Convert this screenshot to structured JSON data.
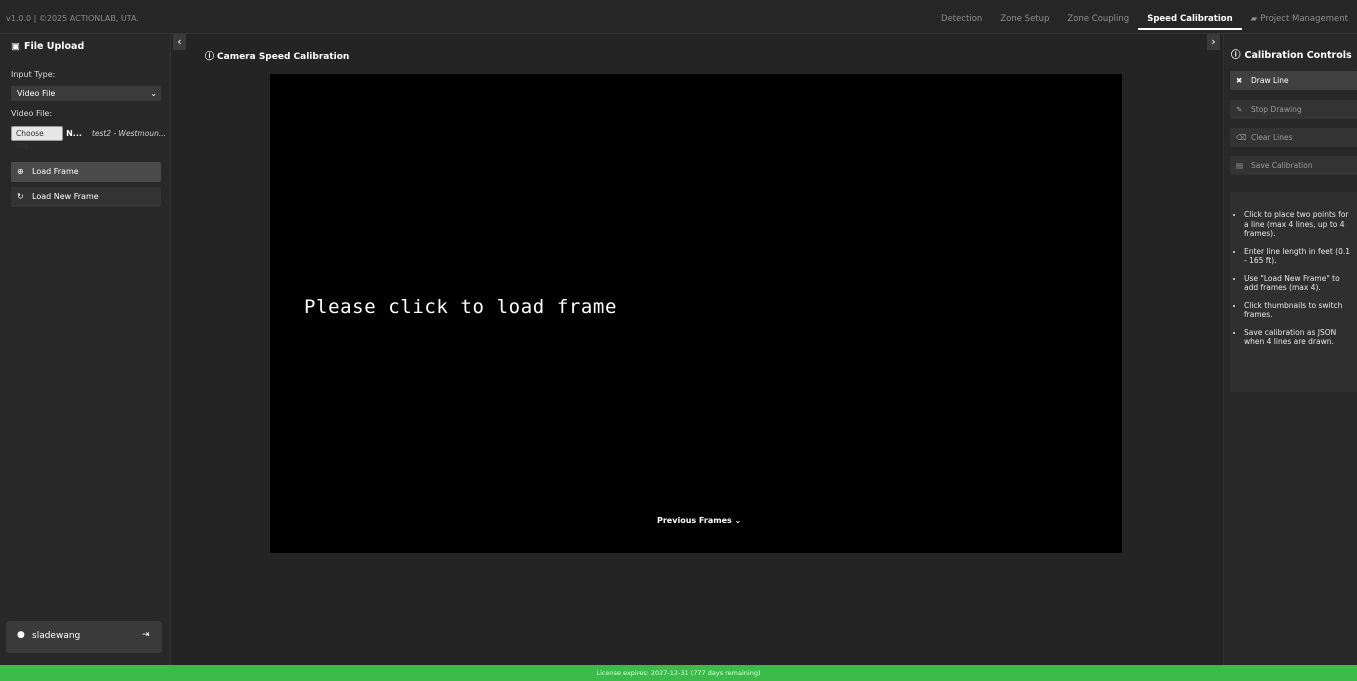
{
  "app": {
    "version_text": "v1.0.0 | ©2025 ACTIONLAB, UTA."
  },
  "nav": {
    "tabs": [
      {
        "label": "Detection",
        "active": false
      },
      {
        "label": "Zone Setup",
        "active": false
      },
      {
        "label": "Zone Coupling",
        "active": false
      },
      {
        "label": "Speed Calibration",
        "active": true
      },
      {
        "label": "Project Management",
        "active": false,
        "icon": "folder-icon"
      }
    ]
  },
  "left_panel": {
    "title": "File Upload",
    "input_type_label": "Input Type:",
    "input_type_value": "Video File",
    "video_file_label": "Video File:",
    "choose_file_label": "Choose File",
    "file_n": "N...",
    "file_name": "test2 - Westmoun...",
    "load_frame_label": "Load Frame",
    "load_new_frame_label": "Load New Frame",
    "username": "sladewang"
  },
  "center": {
    "title": "Camera Speed Calibration",
    "placeholder": "Please click to load frame",
    "previous_frames_label": "Previous Frames"
  },
  "right_panel": {
    "title": "Calibration Controls",
    "buttons": [
      {
        "label": "Draw Line",
        "enabled": true,
        "icon": "draw-line-icon"
      },
      {
        "label": "Stop Drawing",
        "enabled": false,
        "icon": "stop-drawing-icon"
      },
      {
        "label": "Clear Lines",
        "enabled": false,
        "icon": "eraser-icon"
      },
      {
        "label": "Save Calibration",
        "enabled": false,
        "icon": "save-icon"
      }
    ],
    "instructions": [
      "Click to place two points for a line (max 4 lines, up to 4 frames).",
      "Enter line length in feet (0.1 - 165 ft).",
      "Use \"Load New Frame\" to add frames (max 4).",
      "Click thumbnails to switch frames.",
      "Save calibration as JSON when 4 lines are drawn."
    ]
  },
  "footer": {
    "license_text": "License expires: 2027-12-31 (777 days remaining)"
  },
  "colors": {
    "background": "#242424",
    "footer": "#3dbb4a",
    "canvas": "#000000"
  }
}
